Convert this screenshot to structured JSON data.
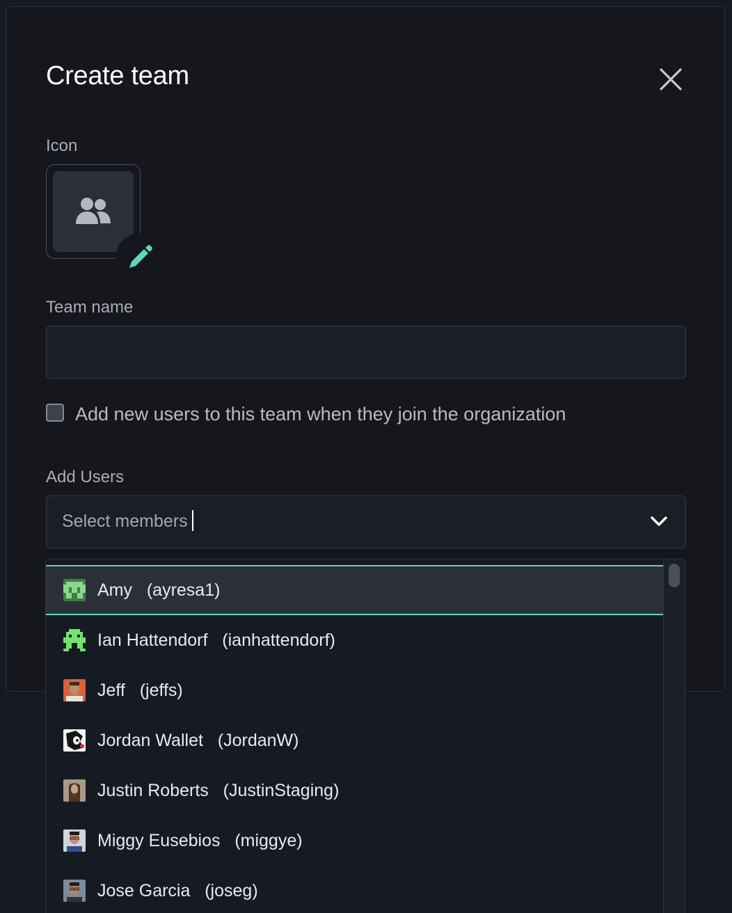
{
  "modal": {
    "title": "Create team",
    "icon_label": "Icon",
    "team_name_label": "Team name",
    "team_name_value": "",
    "auto_add_checkbox": {
      "label": "Add new users to this team when they join the organization",
      "checked": false
    },
    "add_users_label": "Add Users",
    "members_select": {
      "placeholder": "Select members"
    }
  },
  "dropdown": {
    "options": [
      {
        "name": "Amy",
        "username": "(ayresa1)",
        "avatar": "green-pixel-monster",
        "highlighted": true
      },
      {
        "name": "Ian Hattendorf",
        "username": "(ianhattendorf)",
        "avatar": "green-space-invader",
        "highlighted": false
      },
      {
        "name": "Jeff",
        "username": "(jeffs)",
        "avatar": "photo-jeff",
        "highlighted": false
      },
      {
        "name": "Jordan Wallet",
        "username": "(JordanW)",
        "avatar": "sonic-character",
        "highlighted": false
      },
      {
        "name": "Justin Roberts",
        "username": "(JustinStaging)",
        "avatar": "photo-justin",
        "highlighted": false
      },
      {
        "name": "Miggy Eusebios",
        "username": "(miggye)",
        "avatar": "photo-miggy",
        "highlighted": false
      },
      {
        "name": "Jose Garcia",
        "username": "(joseg)",
        "avatar": "photo-jose",
        "highlighted": false
      }
    ]
  },
  "icons": {
    "close": "close-icon",
    "team": "users-icon",
    "edit": "pencil-icon",
    "chevron": "chevron-down-icon"
  },
  "colors": {
    "accent": "#5ed6c3",
    "background": "#15171d"
  }
}
